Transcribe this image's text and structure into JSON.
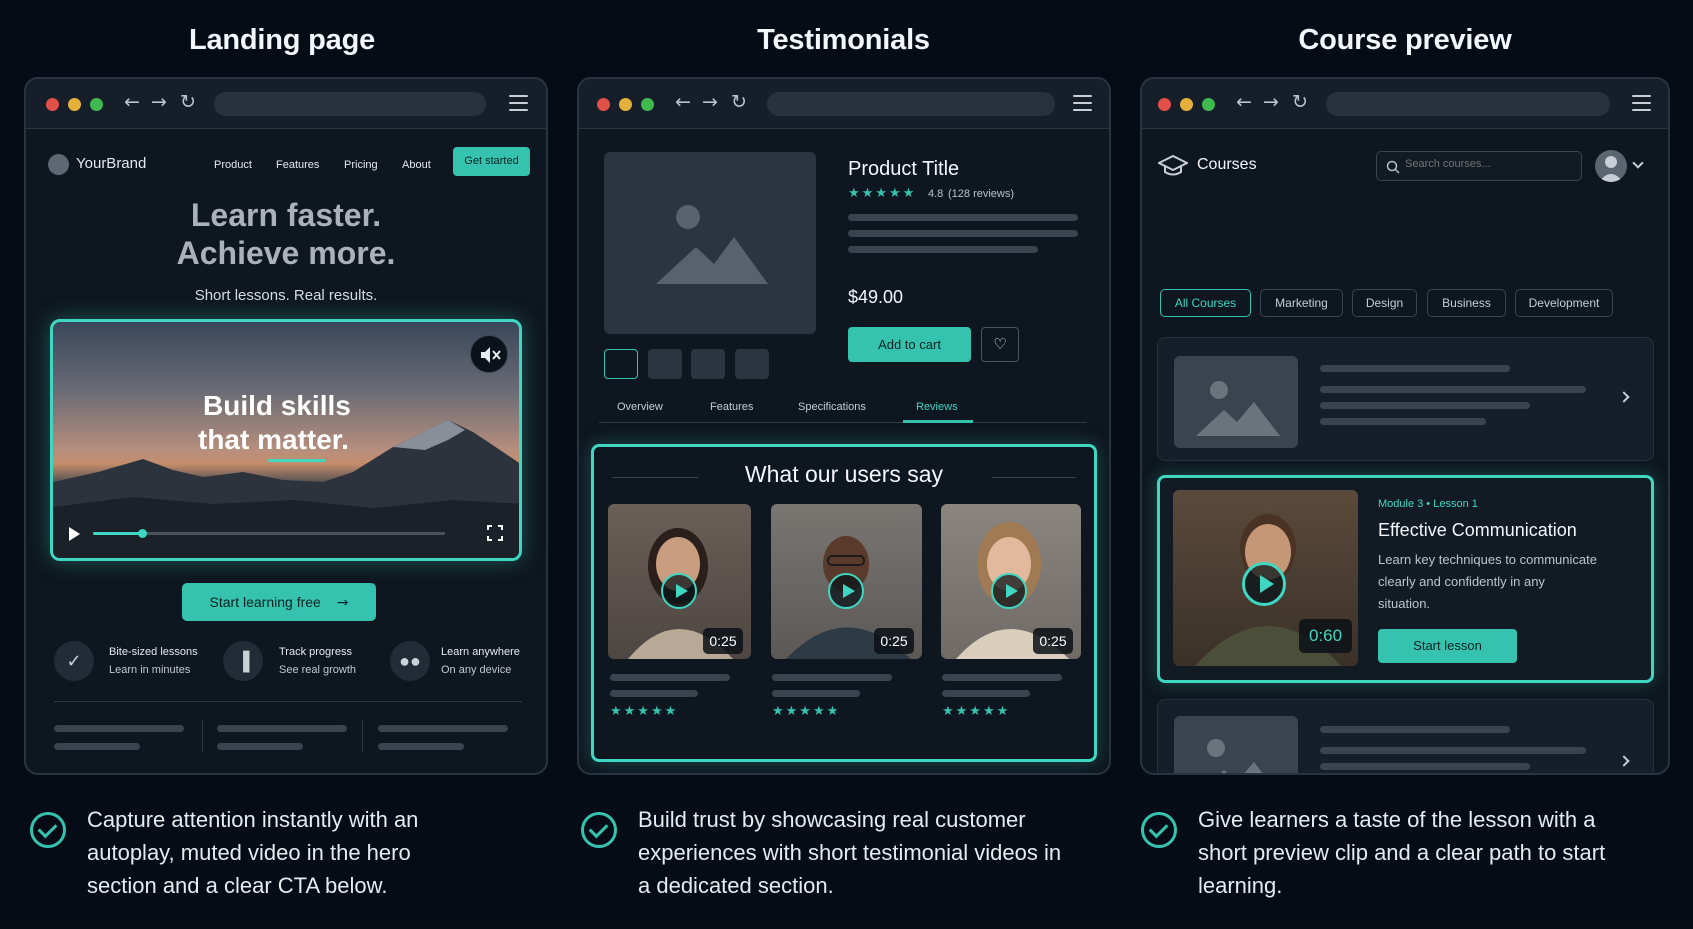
{
  "columns": {
    "landing": {
      "heading": "Landing page",
      "brand": "YourBrand",
      "nav": [
        "Product",
        "Features",
        "Pricing",
        "About"
      ],
      "cta_top": "Get started",
      "headline_1": "Learn faster.",
      "headline_2": "Achieve more.",
      "subhead": "Short lessons. Real results.",
      "video_title_1": "Build skills",
      "video_title_2": "that matter.",
      "video_progress": 0.14,
      "cta_main": "Start learning free",
      "features": [
        {
          "title": "Bite-sized lessons",
          "sub": "Learn in minutes",
          "icon": "check-icon"
        },
        {
          "title": "Track progress",
          "sub": "See real growth",
          "icon": "bar-chart-icon"
        },
        {
          "title": "Learn anywhere",
          "sub": "On any device",
          "icon": "users-icon"
        }
      ],
      "caption": "Capture attention instantly with an autoplay, muted video in the hero section and a clear CTA below."
    },
    "testimonials": {
      "heading": "Testimonials",
      "product_title": "Product Title",
      "rating": "4.8",
      "reviews": "(128 reviews)",
      "price": "$49.00",
      "add_to_cart": "Add to cart",
      "tabs": [
        "Overview",
        "Features",
        "Specifications",
        "Reviews"
      ],
      "active_tab": "Reviews",
      "section_title": "What our users say",
      "videos": [
        {
          "duration": "0:25",
          "stars": "★★★★★"
        },
        {
          "duration": "0:25",
          "stars": "★★★★★"
        },
        {
          "duration": "0:25",
          "stars": "★★★★★"
        }
      ],
      "caption": "Build trust by showcasing real customer experiences with short testimonial videos in a dedicated section."
    },
    "course": {
      "heading": "Course preview",
      "app_title": "Courses",
      "search_placeholder": "Search courses...",
      "chips": [
        "All Courses",
        "Marketing",
        "Design",
        "Business",
        "Development"
      ],
      "active_chip": "All Courses",
      "lesson_meta": "Module 3 • Lesson 1",
      "lesson_title": "Effective Communication",
      "lesson_desc_1": "Learn key techniques to communicate",
      "lesson_desc_2": "clearly and confidently in any",
      "lesson_desc_3": "situation.",
      "lesson_duration": "0:60",
      "start_lesson": "Start lesson",
      "caption": "Give learners a taste of the lesson with a short preview clip and a clear path to start learning."
    }
  },
  "colors": {
    "accent": "#35c3b0",
    "background": "#060c16",
    "window": "#0e161f"
  }
}
